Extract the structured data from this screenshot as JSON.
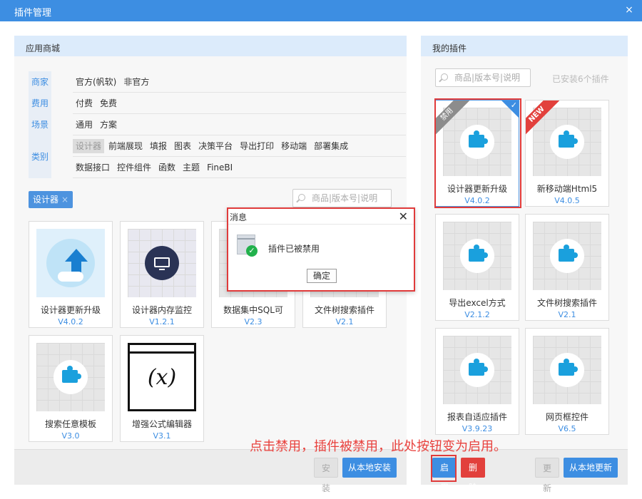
{
  "window": {
    "title": "插件管理",
    "close_glyph": "×"
  },
  "left_panel": {
    "title": "应用商城",
    "filters": [
      {
        "category": "商家",
        "options": [
          "官方(帆软)",
          "非官方"
        ]
      },
      {
        "category": "费用",
        "options": [
          "付费",
          "免费"
        ]
      },
      {
        "category": "场景",
        "options": [
          "通用",
          "方案"
        ]
      },
      {
        "category": "类别",
        "options_row1": [
          "设计器",
          "前端展现",
          "填报",
          "图表",
          "决策平台",
          "导出打印",
          "移动端",
          "部署集成"
        ],
        "options_row2": [
          "数据接口",
          "控件组件",
          "函数",
          "主题",
          "FineBI"
        ],
        "selected": "设计器"
      }
    ],
    "active_tag": {
      "label": "设计器",
      "remove_glyph": "×"
    },
    "search_placeholder": "商品|版本号|说明",
    "cards": [
      {
        "name": "设计器更新升级",
        "version": "V4.0.2",
        "icon": "cloud-upload-icon"
      },
      {
        "name": "设计器内存监控",
        "version": "V1.2.1",
        "icon": "monitor-gauge-icon"
      },
      {
        "name": "数据集中SQL可",
        "version": "V2.3",
        "icon": "puzzle-icon"
      },
      {
        "name": "文件树搜索插件",
        "version": "V2.1",
        "icon": "puzzle-icon"
      },
      {
        "name": "搜索任意模板",
        "version": "V3.0",
        "icon": "puzzle-icon"
      },
      {
        "name": "增强公式编辑器",
        "version": "V3.1",
        "icon": "formula-x-icon",
        "icon_text": "(x)"
      }
    ],
    "buttons": {
      "install": "安装",
      "install_local": "从本地安装"
    }
  },
  "right_panel": {
    "title": "我的插件",
    "search_placeholder": "商品|版本号|说明",
    "installed_count": "已安装6个插件",
    "cards": [
      {
        "name": "设计器更新升级",
        "version": "V4.0.2",
        "ribbon": "禁用",
        "checked": true
      },
      {
        "name": "新移动端Html5",
        "version": "V4.0.5",
        "ribbon": "NEW"
      },
      {
        "name": "导出excel方式",
        "version": "V2.1.2"
      },
      {
        "name": "文件树搜索插件",
        "version": "V2.1"
      },
      {
        "name": "报表自适应插件",
        "version": "V3.9.23"
      },
      {
        "name": "网页框控件",
        "version": "V6.5"
      }
    ],
    "buttons": {
      "enable": "启用",
      "delete": "删除",
      "update": "更新",
      "update_local": "从本地更新"
    }
  },
  "dialog": {
    "title": "消息",
    "message": "插件已被禁用",
    "ok": "确定",
    "close_glyph": "✕"
  },
  "annotation": "点击禁用，插件被禁用，此处按钮变为启用。",
  "colors": {
    "titlebar": "#3d8ee2",
    "accent": "#3d8ee2",
    "highlight": "#e03b3b",
    "delete": "#e2403c"
  }
}
